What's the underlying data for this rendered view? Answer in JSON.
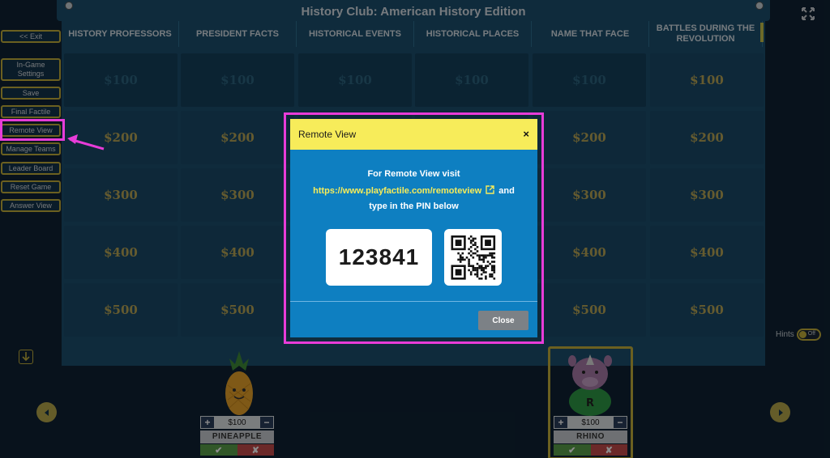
{
  "game": {
    "title": "History Club: American History Edition"
  },
  "sidebar": {
    "exit": "<< Exit",
    "settings": "In-Game Settings",
    "save": "Save",
    "final": "Final Factile",
    "remote": "Remote View",
    "teams": "Manage Teams",
    "leader": "Leader Board",
    "reset": "Reset Game",
    "answer": "Answer View"
  },
  "board": {
    "categories": [
      "HISTORY PROFESSORS",
      "PRESIDENT FACTS",
      "HISTORICAL EVENTS",
      "HISTORICAL PLACES",
      "NAME THAT FACE",
      "BATTLES DURING THE REVOLUTION"
    ],
    "values": [
      "$100",
      "$200",
      "$300",
      "$400",
      "$500"
    ],
    "state": [
      [
        "used",
        "used",
        "used",
        "used",
        "used",
        "open"
      ],
      [
        "open",
        "open",
        "open",
        "open",
        "open",
        "open"
      ],
      [
        "open",
        "open",
        "open",
        "open",
        "open",
        "open"
      ],
      [
        "open",
        "open",
        "open",
        "open",
        "open",
        "open"
      ],
      [
        "open",
        "open",
        "open",
        "open",
        "open",
        "open"
      ]
    ]
  },
  "modal": {
    "title": "Remote View",
    "close_x": "×",
    "line1": "For Remote View visit",
    "link": "https://www.playfactile.com/remoteview",
    "and": "and",
    "line3": "type in the PIN below",
    "pin": "123841",
    "close": "Close"
  },
  "teams": [
    {
      "name": "PINEAPPLE",
      "score": "$100"
    },
    {
      "name": "RHINO",
      "score": "$100"
    }
  ],
  "hints": {
    "label": "Hints",
    "state": "Off"
  },
  "colors": {
    "accent": "#c3b03b",
    "highlight": "#e83cd8",
    "modal": "#0e7fc1",
    "modal_header": "#f7ec5a"
  }
}
